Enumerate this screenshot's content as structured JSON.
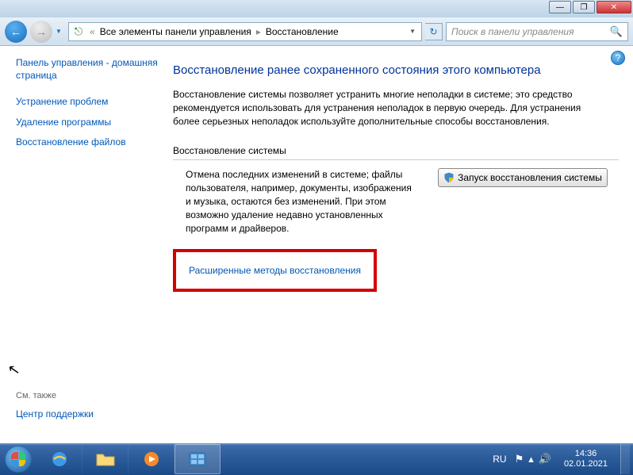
{
  "chrome": {
    "min": "—",
    "max": "❐",
    "close": "✕"
  },
  "nav": {
    "back": "←",
    "fwd": "→",
    "dd": "▼",
    "addr_icon": "⎋",
    "crumb1": "Все элементы панели управления",
    "sep": "▸",
    "crumb2": "Восстановление",
    "addr_dd": "▼",
    "refresh": "↻",
    "search_placeholder": "Поиск в панели управления",
    "search_icon": "🔍"
  },
  "sidebar": {
    "home": "Панель управления - домашняя страница",
    "link1": "Устранение проблем",
    "link2": "Удаление программы",
    "link3": "Восстановление файлов",
    "also": "См. также",
    "support": "Центр поддержки"
  },
  "content": {
    "help": "?",
    "title": "Восстановление ранее сохраненного состояния этого компьютера",
    "desc": "Восстановление системы позволяет устранить многие неполадки в системе; это средство рекомендуется использовать для устранения неполадок в первую очередь. Для устранения более серьезных неполадок используйте дополнительные способы восстановления.",
    "section": "Восстановление системы",
    "row_text": "Отмена последних изменений в системе; файлы пользователя, например, документы, изображения и музыка, остаются без изменений. При этом возможно удаление недавно установленных программ и драйверов.",
    "button": "Запуск восстановления системы",
    "adv_link": "Расширенные методы восстановления"
  },
  "taskbar": {
    "lang": "RU",
    "flag": "⚑",
    "tray_up": "▴",
    "speaker": "🔊",
    "time": "14:36",
    "date": "02.01.2021"
  }
}
